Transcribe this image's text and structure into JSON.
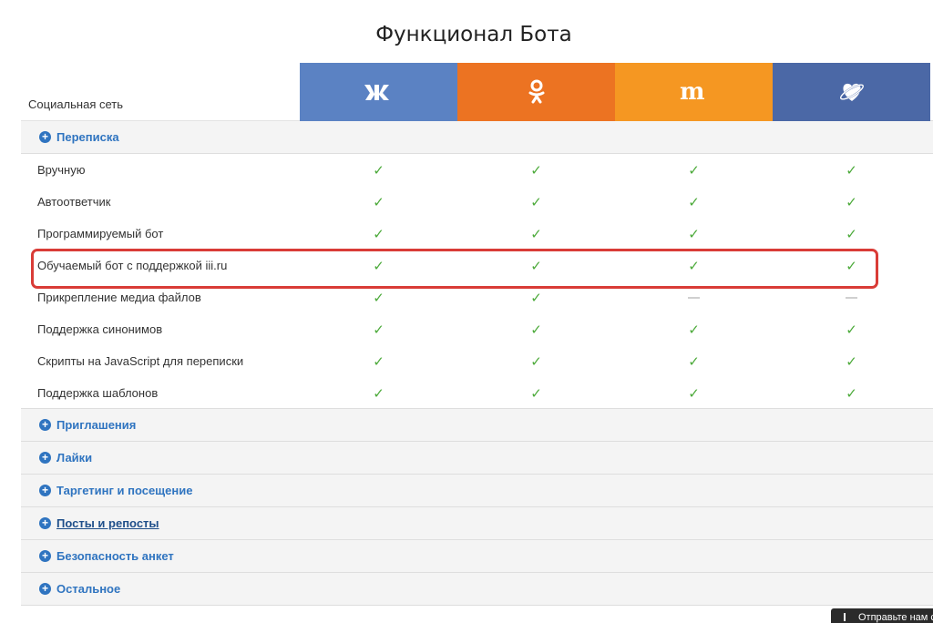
{
  "page": {
    "title": "Функционал Бота"
  },
  "header": {
    "label": "Социальная сеть",
    "networks": [
      {
        "name": "vk",
        "icon": "vk-logo-icon",
        "color": "#5b82c3"
      },
      {
        "name": "ok",
        "icon": "odnoklassniki-logo-icon",
        "color": "#ec7322"
      },
      {
        "name": "mamba",
        "icon": "mamba-logo-icon",
        "color": "#f59722"
      },
      {
        "name": "loveplanet",
        "icon": "loveplanet-logo-icon",
        "color": "#4b68a6"
      }
    ]
  },
  "sections": [
    {
      "label": "Переписка",
      "expanded": true,
      "rows": [
        {
          "label": "Вручную",
          "support": [
            true,
            true,
            true,
            true
          ]
        },
        {
          "label": "Автоответчик",
          "support": [
            true,
            true,
            true,
            true
          ]
        },
        {
          "label": "Программируемый бот",
          "support": [
            true,
            true,
            true,
            true
          ]
        },
        {
          "label": "Обучаемый бот с поддержкой iii.ru",
          "support": [
            true,
            true,
            true,
            true
          ],
          "highlighted": true
        },
        {
          "label": "Прикрепление медиа файлов",
          "support": [
            true,
            true,
            false,
            false
          ]
        },
        {
          "label": "Поддержка синонимов",
          "support": [
            true,
            true,
            true,
            true
          ]
        },
        {
          "label": "Скрипты на JavaScript для переписки",
          "support": [
            true,
            true,
            true,
            true
          ]
        },
        {
          "label": "Поддержка шаблонов",
          "support": [
            true,
            true,
            true,
            true
          ]
        }
      ]
    },
    {
      "label": "Приглашения",
      "expanded": false
    },
    {
      "label": "Лайки",
      "expanded": false
    },
    {
      "label": "Таргетинг и посещение",
      "expanded": false
    },
    {
      "label": "Посты и репосты",
      "expanded": false,
      "hovered": true
    },
    {
      "label": "Безопасность анкет",
      "expanded": false
    },
    {
      "label": "Остальное",
      "expanded": false
    }
  ],
  "feedback": {
    "label": "Отправьте нам сообщение"
  }
}
